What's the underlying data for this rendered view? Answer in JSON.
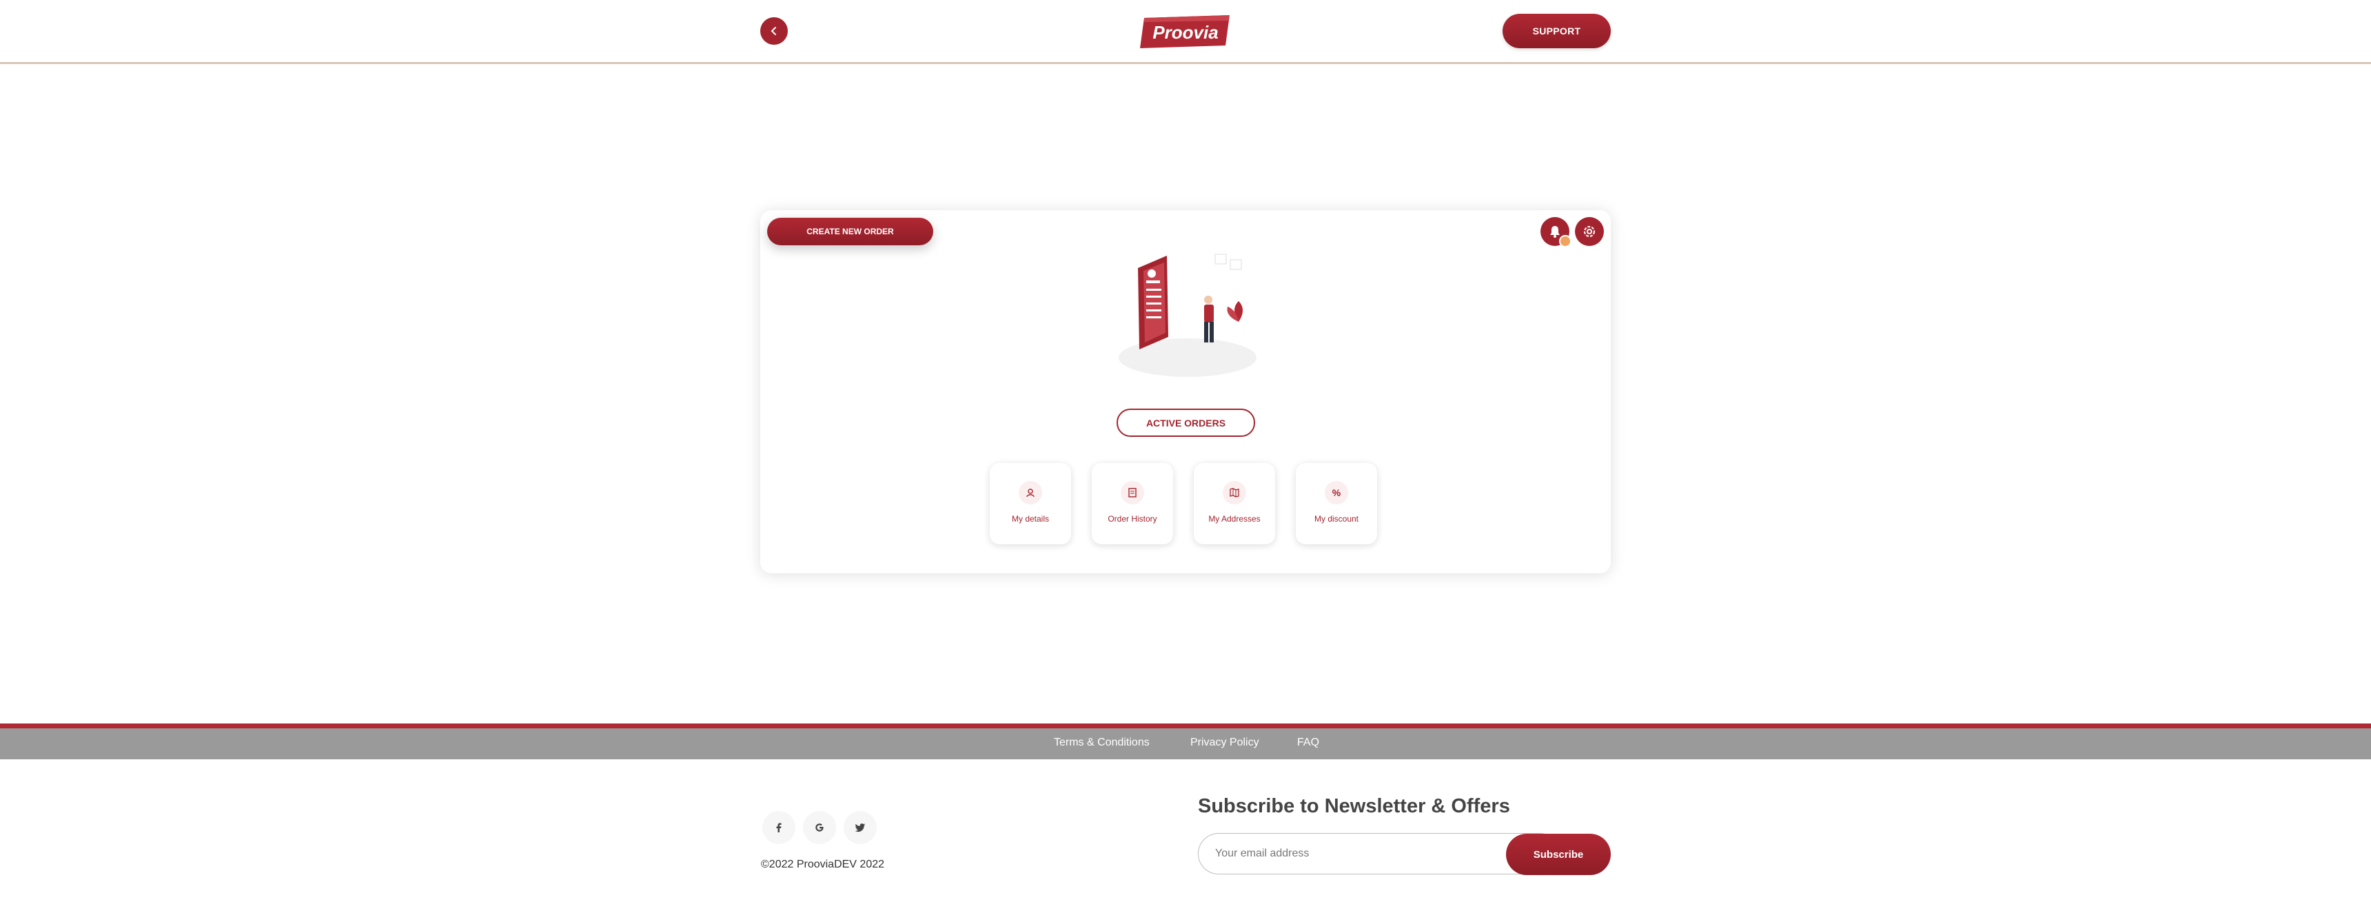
{
  "header": {
    "logo_text": "Proovia",
    "support_label": "SUPPORT"
  },
  "card": {
    "create_order_label": "CREATE NEW ORDER",
    "active_orders_label": "ACTIVE ORDERS",
    "tiles": [
      {
        "label": "My details",
        "icon": "user-icon"
      },
      {
        "label": "Order History",
        "icon": "document-icon"
      },
      {
        "label": "My Addresses",
        "icon": "map-icon"
      },
      {
        "label": "My discount",
        "icon": "percent-icon"
      }
    ],
    "discount_symbol": "%"
  },
  "footer": {
    "links": [
      "Terms & Conditions",
      "Privacy Policy",
      "FAQ"
    ],
    "social": [
      "facebook-icon",
      "google-icon",
      "twitter-icon"
    ],
    "copyright": "©2022 ProoviaDEV 2022",
    "newsletter_title": "Subscribe to Newsletter & Offers",
    "email_placeholder": "Your email address",
    "subscribe_label": "Subscribe"
  },
  "colors": {
    "brand_red": "#a3242e",
    "footer_grey": "#9a9a9a",
    "notification_dot": "#f0a35c"
  }
}
